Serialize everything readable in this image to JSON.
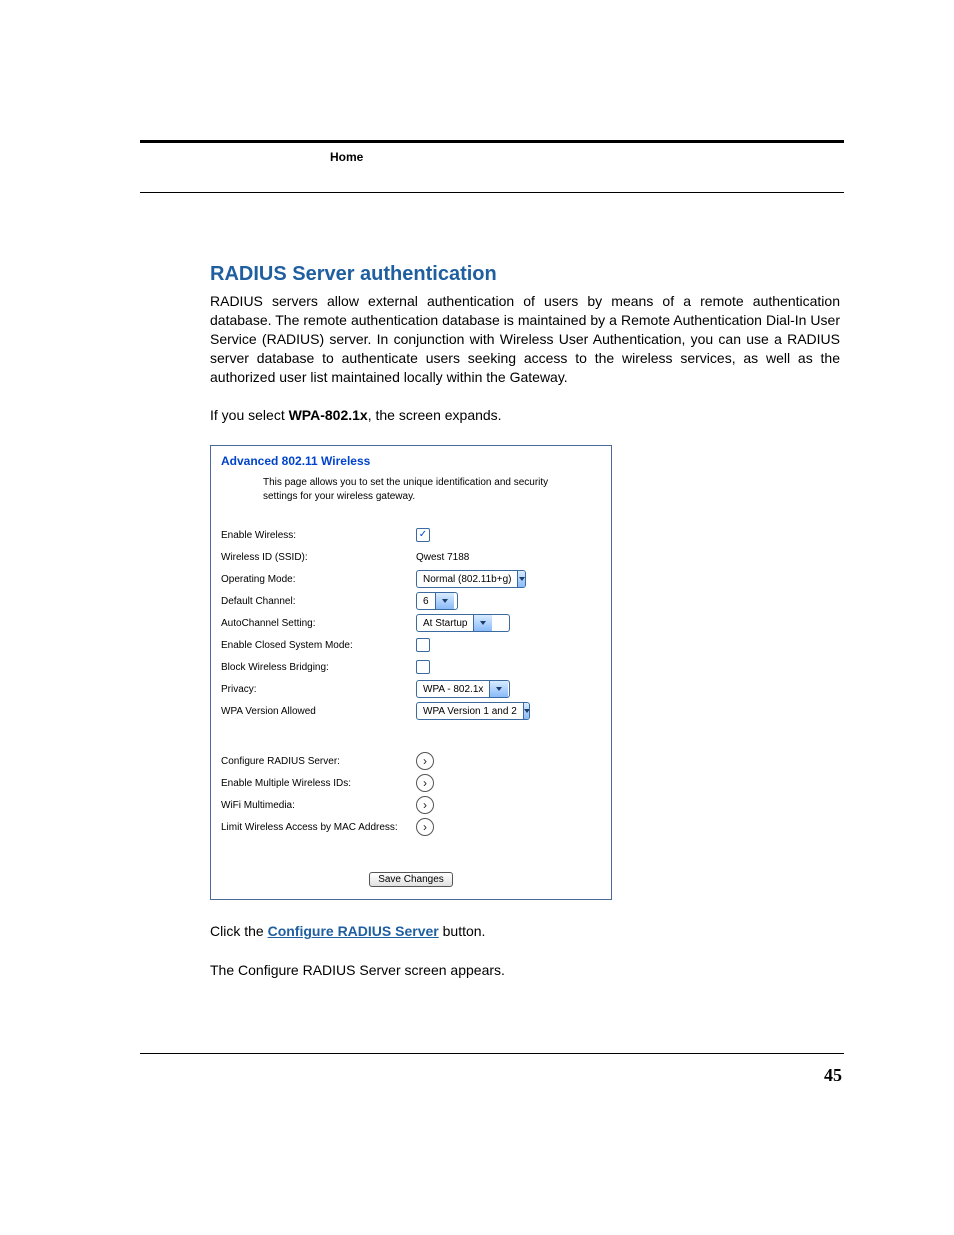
{
  "header": {
    "label": "Home"
  },
  "section": {
    "title": "RADIUS Server authentication",
    "intro": "RADIUS servers allow external authentication of users by means of a remote authentication database. The remote authentication database is maintained by a Remote Authentication Dial-In User Service (RADIUS) server. In conjunction with Wireless User Authentication, you can use a RADIUS server database to authenticate users seeking access to the wireless services, as well as the authorized user list maintained locally within the Gateway.",
    "lead_in_pre": "If you select ",
    "lead_in_bold": "WPA-802.1x",
    "lead_in_post": ", the screen expands."
  },
  "shot": {
    "title": "Advanced 802.11 Wireless",
    "desc": "This page allows you to set the unique identification and security settings for your wireless gateway.",
    "rows": {
      "enable_wireless": {
        "label": "Enable Wireless:",
        "checked": true
      },
      "ssid": {
        "label": "Wireless ID (SSID):",
        "value": "Qwest 7188"
      },
      "op_mode": {
        "label": "Operating Mode:",
        "value": "Normal (802.11b+g)"
      },
      "channel": {
        "label": "Default Channel:",
        "value": "6"
      },
      "autochan": {
        "label": "AutoChannel Setting:",
        "value": "At Startup"
      },
      "closed": {
        "label": "Enable Closed System Mode:",
        "checked": false
      },
      "block_bridge": {
        "label": "Block Wireless Bridging:",
        "checked": false
      },
      "privacy": {
        "label": "Privacy:",
        "value": "WPA - 802.1x"
      },
      "wpa_ver": {
        "label": "WPA Version Allowed",
        "value": "WPA Version 1 and 2"
      },
      "cfg_radius": {
        "label": "Configure RADIUS Server:"
      },
      "multi_ssid": {
        "label": "Enable Multiple Wireless IDs:"
      },
      "wmm": {
        "label": "WiFi Multimedia:"
      },
      "mac_limit": {
        "label": "Limit Wireless Access by MAC Address:"
      }
    },
    "save_label": "Save Changes"
  },
  "after": {
    "click_pre": "Click the ",
    "click_link": "Configure RADIUS Server",
    "click_post": " button.",
    "result": "The Configure RADIUS Server screen appears."
  },
  "page_number": "45"
}
